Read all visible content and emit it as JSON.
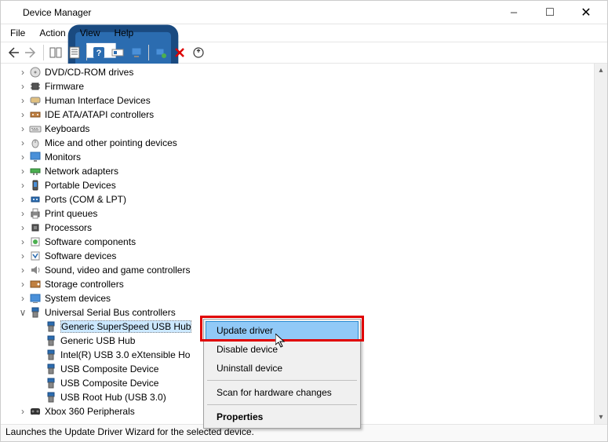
{
  "window": {
    "title": "Device Manager"
  },
  "menus": {
    "file": "File",
    "action": "Action",
    "view": "View",
    "help": "Help"
  },
  "tree": {
    "items": [
      {
        "label": "DVD/CD-ROM drives",
        "icon": "disc"
      },
      {
        "label": "Firmware",
        "icon": "chip"
      },
      {
        "label": "Human Interface Devices",
        "icon": "hid"
      },
      {
        "label": "IDE ATA/ATAPI controllers",
        "icon": "ide"
      },
      {
        "label": "Keyboards",
        "icon": "keyboard"
      },
      {
        "label": "Mice and other pointing devices",
        "icon": "mouse"
      },
      {
        "label": "Monitors",
        "icon": "monitor"
      },
      {
        "label": "Network adapters",
        "icon": "network"
      },
      {
        "label": "Portable Devices",
        "icon": "portable"
      },
      {
        "label": "Ports (COM & LPT)",
        "icon": "port"
      },
      {
        "label": "Print queues",
        "icon": "printer"
      },
      {
        "label": "Processors",
        "icon": "cpu"
      },
      {
        "label": "Software components",
        "icon": "swc"
      },
      {
        "label": "Software devices",
        "icon": "swd"
      },
      {
        "label": "Sound, video and game controllers",
        "icon": "sound"
      },
      {
        "label": "Storage controllers",
        "icon": "storage"
      },
      {
        "label": "System devices",
        "icon": "system"
      },
      {
        "label": "Universal Serial Bus controllers",
        "icon": "usb"
      },
      {
        "label": "Xbox 360 Peripherals",
        "icon": "xbox"
      }
    ],
    "usb_children": [
      "Generic SuperSpeed USB Hub",
      "Generic USB Hub",
      "Intel(R) USB 3.0 eXtensible Ho",
      "USB Composite Device",
      "USB Composite Device",
      "USB Root Hub (USB 3.0)"
    ]
  },
  "ctx": {
    "items": [
      "Update driver",
      "Disable device",
      "Uninstall device",
      "Scan for hardware changes",
      "Properties"
    ]
  },
  "statusbar": "Launches the Update Driver Wizard for the selected device."
}
